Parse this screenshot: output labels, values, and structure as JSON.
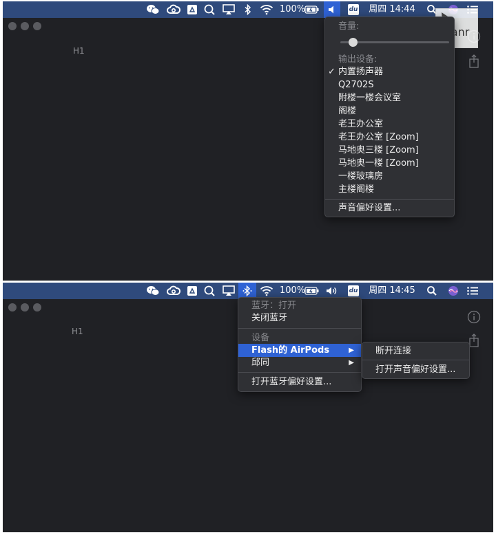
{
  "top": {
    "menubar": {
      "battery": "100%",
      "clock": "周四 14:44",
      "du": "du"
    },
    "volume_menu": {
      "volume_label": "音量:",
      "volume_level": 0.08,
      "output_label": "输出设备:",
      "devices": [
        {
          "label": "内置扬声器",
          "checked": true
        },
        {
          "label": "Q2702S",
          "checked": false
        },
        {
          "label": "附楼一楼会议室",
          "checked": false
        },
        {
          "label": "阁楼",
          "checked": false
        },
        {
          "label": "老王办公室",
          "checked": false
        },
        {
          "label": "老王办公室 [Zoom]",
          "checked": false
        },
        {
          "label": "马地奥三楼 [Zoom]",
          "checked": false
        },
        {
          "label": "马地奥一楼 [Zoom]",
          "checked": false
        },
        {
          "label": "一楼玻璃房",
          "checked": false
        },
        {
          "label": "主楼阁楼",
          "checked": false
        }
      ],
      "prefs": "声音偏好设置...",
      "check_mark": "✓"
    },
    "doc_label": "H1",
    "watermark": "ifanr"
  },
  "bottom": {
    "menubar": {
      "battery": "100%",
      "clock": "周四 14:45",
      "du": "du"
    },
    "bluetooth_menu": {
      "status": "蓝牙：打开",
      "toggle": "关闭蓝牙",
      "devices_label": "设备",
      "devices": [
        {
          "label": "Flash的 AirPods",
          "selected": true
        },
        {
          "label": "邱同",
          "selected": false
        }
      ],
      "prefs": "打开蓝牙偏好设置...",
      "arrow": "▶"
    },
    "submenu": {
      "disconnect": "断开连接",
      "sound_prefs": "打开声音偏好设置..."
    },
    "doc_label": "H1"
  },
  "colors": {
    "menubar": "#2f4a7c",
    "highlight": "#2f62d4",
    "menu_bg": "#2f3034",
    "window_bg": "#202125"
  }
}
